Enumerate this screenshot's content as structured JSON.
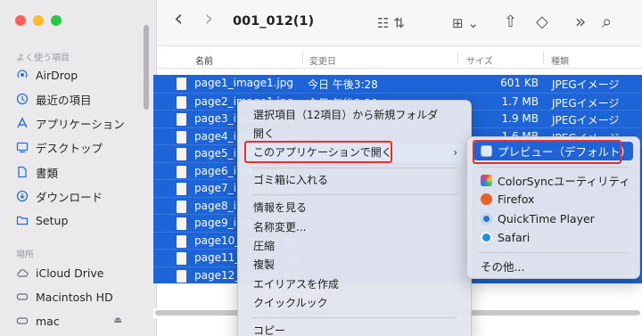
{
  "toolbar": {
    "folder_title": "001_012(1)",
    "back_glyph": "‹",
    "forward_glyph": "›",
    "view_glyph": "☷ ⇅",
    "group_glyph": "⊞ ⌄",
    "share_glyph": "⇧",
    "tag_glyph": "◇",
    "more_glyph": "»",
    "search_glyph": "⌕"
  },
  "sidebar": {
    "favorites_header": "よく使う項目",
    "favorites": [
      {
        "label": "AirDrop",
        "icon": "airdrop-icon"
      },
      {
        "label": "最近の項目",
        "icon": "clock-icon"
      },
      {
        "label": "アプリケーション",
        "icon": "apps-icon"
      },
      {
        "label": "デスクトップ",
        "icon": "desktop-icon"
      },
      {
        "label": "書類",
        "icon": "document-icon"
      },
      {
        "label": "ダウンロード",
        "icon": "download-icon"
      },
      {
        "label": "Setup",
        "icon": "folder-icon"
      }
    ],
    "locations_header": "場所",
    "locations": [
      {
        "label": "iCloud Drive",
        "icon": "cloud-icon"
      },
      {
        "label": "Macintosh HD",
        "icon": "disk-icon"
      },
      {
        "label": "mac",
        "icon": "computer-icon",
        "eject": "⏏"
      }
    ]
  },
  "columns": {
    "name": "名前",
    "modified": "変更日",
    "size": "サイズ",
    "kind": "種類"
  },
  "files": [
    {
      "name": "page1_image1.jpg",
      "date": "今日 午後3:28",
      "size": "601 KB",
      "kind": "JPEGイメージ"
    },
    {
      "name": "page2_image1.jpg",
      "date": "今日 午後3:28",
      "size": "1.7 MB",
      "kind": "JPEGイメージ"
    },
    {
      "name": "page3_image1.jpg",
      "date": "",
      "size": "1.9 MB",
      "kind": "JPEGイメージ"
    },
    {
      "name": "page4_image1.jpg",
      "date": "",
      "size": "1.6 MB",
      "kind": "JPEGイメージ"
    },
    {
      "name": "page5_image1.jpg",
      "date": "",
      "size": "",
      "kind": ""
    },
    {
      "name": "page6_image1.jpg",
      "date": "",
      "size": "",
      "kind": ""
    },
    {
      "name": "page7_image1.jpg",
      "date": "",
      "size": "",
      "kind": ""
    },
    {
      "name": "page8_image1.jpg",
      "date": "",
      "size": "",
      "kind": ""
    },
    {
      "name": "page9_image1.jpg",
      "date": "",
      "size": "",
      "kind": ""
    },
    {
      "name": "page10_image1.jpg",
      "date": "",
      "size": "",
      "kind": ""
    },
    {
      "name": "page11_image1.jpg",
      "date": "",
      "size": "",
      "kind": ""
    },
    {
      "name": "page12_image1.jpg",
      "date": "",
      "size": "",
      "kind": ""
    }
  ],
  "context_menu": {
    "new_folder": "選択項目（12項目）から新規フォルダ",
    "open": "開く",
    "open_with": "このアプリケーションで開く",
    "open_with_chevron": "›",
    "trash": "ゴミ箱に入れる",
    "get_info": "情報を見る",
    "rename": "名称変更...",
    "compress": "圧縮",
    "duplicate": "複製",
    "make_alias": "エイリアスを作成",
    "quick_look": "クイックルック",
    "copy": "コピー"
  },
  "submenu": {
    "preview": "プレビュー（デフォルト）",
    "apps": [
      {
        "label": "ColorSyncユーティリティ",
        "color": "#7a55c9"
      },
      {
        "label": "Firefox",
        "color": "#e8632a"
      },
      {
        "label": "QuickTime Player",
        "color": "#2a6fd1"
      },
      {
        "label": "Safari",
        "color": "#1e8ff0"
      }
    ],
    "other": "その他..."
  },
  "colors": {
    "selection": "#1d64d8",
    "highlight_box": "#e0322b"
  }
}
